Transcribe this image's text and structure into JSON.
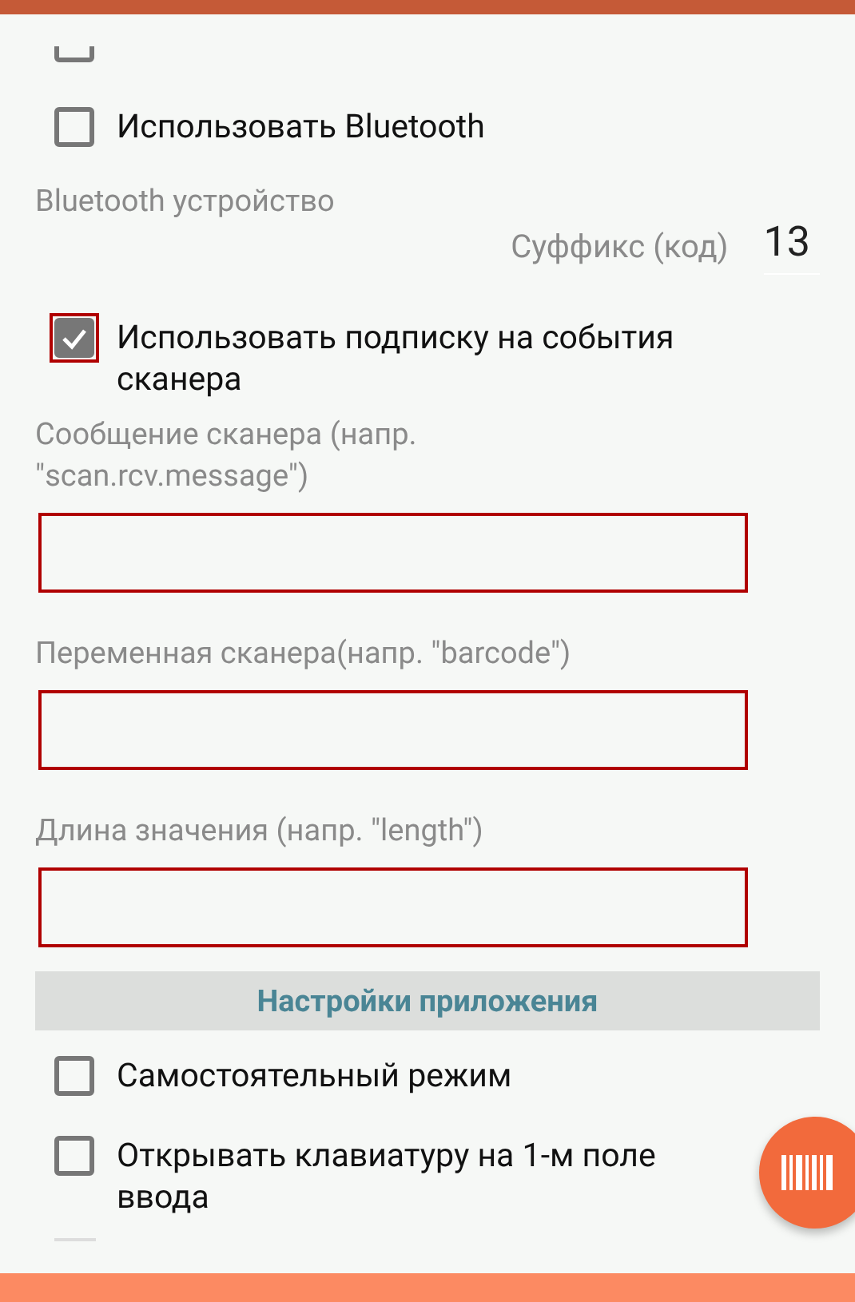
{
  "items": [
    {
      "kind": "partial_checkbox",
      "checked": false
    },
    {
      "kind": "checkbox",
      "label": "Использовать Bluetooth",
      "checked": false,
      "highlighted": false
    },
    {
      "kind": "caption",
      "text": "Bluetooth устройство"
    },
    {
      "kind": "suffix",
      "label": "Суффикс (код)",
      "value": "13"
    },
    {
      "kind": "checkbox",
      "label": "Использовать подписку на события сканера",
      "checked": true,
      "highlighted": true
    },
    {
      "kind": "caption",
      "text": "Сообщение сканера (напр. \"scan.rcv.message\")"
    },
    {
      "kind": "input",
      "highlighted": true
    },
    {
      "kind": "caption",
      "text": "Переменная сканера(напр. \"barcode\")"
    },
    {
      "kind": "input",
      "highlighted": true
    },
    {
      "kind": "caption",
      "text": "Длина значения (напр. \"length\")"
    },
    {
      "kind": "input",
      "highlighted": true
    },
    {
      "kind": "section",
      "title": "Настройки приложения"
    },
    {
      "kind": "checkbox",
      "label": "Самостоятельный режим",
      "checked": false,
      "highlighted": false
    },
    {
      "kind": "checkbox",
      "label": "Открывать клавиатуру на 1-м поле ввода",
      "checked": false,
      "highlighted": false
    },
    {
      "kind": "rule"
    }
  ],
  "scan_button": {
    "kind": "barcode"
  }
}
